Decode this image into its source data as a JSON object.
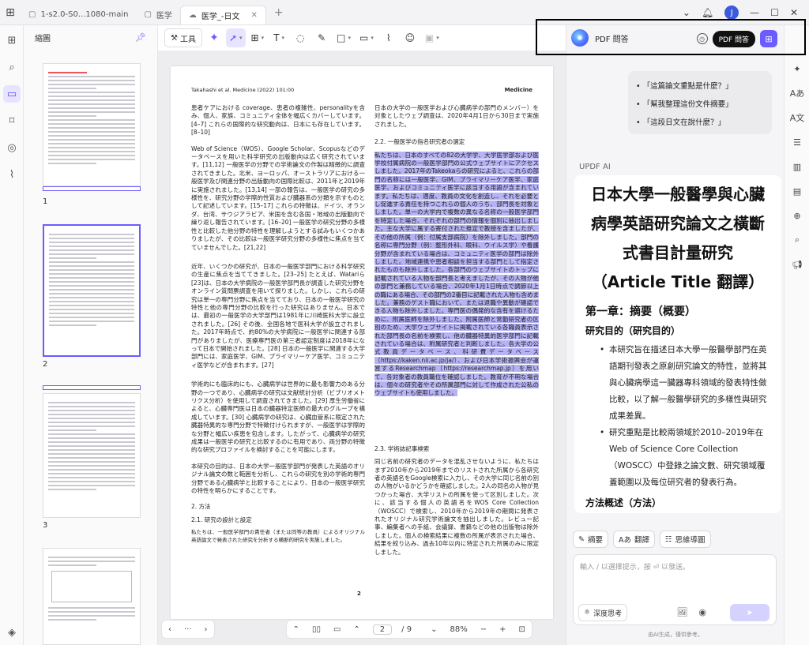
{
  "tabs": [
    {
      "label": "1-s2.0-S0...1080-main",
      "active": false
    },
    {
      "label": "医学",
      "active": false
    },
    {
      "label": "医学_-日文",
      "active": true
    }
  ],
  "avatar_initial": "J",
  "thumbnails": {
    "title": "縮圖",
    "pages": [
      "1",
      "2",
      "3"
    ]
  },
  "toolbar": {
    "tools_label": "工具"
  },
  "document": {
    "header_left": "Takahashi et al. Medicine (2022) 101:00",
    "header_right": "Medicine",
    "left_col": [
      "患者ケアにおける coverage、患者の複雑性、personalityを含み、個人、家族、コミュニティ全体を幅広くカバーしています。[4–7] これらの国際的な研究動向は、日本にも存在しています。[8–10]",
      "Web of Science（WOS）、Google Scholar、Scopusなどのデータベースを用いた科学研究の出版動向は広く研究されています。[11,12] 一般医学の分野での学術論文の作製は精緻的に調査されてきました。北米、ヨーロッパ、オーストラリアにおける一般医学及び関連分野の出版動向の国際比較は、2011年と2019年に実施されました。[13,14] 一部の報告は、一般医学の研究の多様性を、研究分野の学際的性質および臓器系の分類を示すものとして記述しています。[15–17] これらの特徴は、ドイツ、オランダ、台湾、サウジアラビア、米国を含む各国・地域の出版動向で繰り返し報告されています。[16–20] 一般医学の研究分野の多様性と比較した他分野の特性を理解しようとする試みもいくつかありましたが、その比較は一般医学研究分野の多様性に焦点を当てていませんでした。[21,22]",
      "近年、いくつかの研究が、日本の一般医学部門における科学研究の生産に焦点を当ててきました。[23–25] たとえば、Watariら[23]は、日本の大学病院の一般医学部門長が調査した研究分野をオンライン質問票調査を用いて探りました。しかし、これらの研究は単一の専門分野に焦点を当てており、日本の一般医学研究の特性と他の専門分野の比較を行った研究はありません。日本では、最初の一般医学の大学部門は1981年に川崎医科大学に設立されました。[26] その後、全国各地で医科大学が設立されました。2017年時点で、約80%の大学病院に一般医学に関連する部門がありましたが、医療専門医の第三者認定制度は2018年になって日本で開始されました。[28] 日本の一般医学に関連する大学部門には、家庭医学、GIM、プライマリーケア医学、コミュニティ医学などが含まれます。[27]",
      "学術的にも臨床的にも、心臓病学は世界的に最も影響力のある分野の一つであり、心臓病学の研究は文献統計分析（ビブリオメトリクス分析）を使用して調査されてきました。[29] 厚生労働省によると、心臓専門医は日本の臓器特定医師の最大のグループを構成しています。[30] 心臓病学の研究は、心臓血管系に限定された臓器特異的な専門分野で特徴付けられますが、一般医学は学際的な分野と幅広い疾患を包含します。したがって、心臓病学の研究成果は一般医学の研究と比較するのに有用であり、両分野の特徴的な研究プロファイルを検討することを可能にします。",
      "本研究の目的は、日本の大学一般医学部門が発表した英語のオリジナル論文の数と範囲を分析し、これらの研究を別の学術的専門分野である心臓病学と比較することにより、日本の一般医学研究の特性を明らかにすることです。"
    ],
    "left_h_methods": "2. 方法",
    "left_h_design": "2.1. 研究の設計と設定",
    "left_tail": "私たちは、一般医学部門の責任者（または同等の教員）によるオリジナル英語論文で発表された研究を分析する横断的研究を実施しました。",
    "right_top": "日本の大学の一般医学および心臓病学の部門のメンバー）を対象としたウェブ調査は、2020年4月1日から30日まで実施されました。",
    "right_h_22": "2.2. 一般医学の指名研究者の選定",
    "right_highlight": "私たちは、日本のすべての82の大学学、大学医学部および医学校付属病院の一般医学部門の公式ウェブサイトにアクセスしました。2017年のTakeokaらの研究によると、これらの部門の名称には一般医学、GIM、プライマリーケア医学、家庭医学、およびコミュニティ医学に該当する用語が含まれています。私たちは、適度、教員の文化を創造し、それを必要とし促進する責任を持つこれらの個人のうち、部門長を対象としました。単一の大学内で複数の異なる名称の一般医学部門を特定した場合、それぞれの部門の情報を個別に抽出しました。主な大学に属する寄付された推定で教授を含ましたが、その他の所属（例：付属支部病院）を除外しました。部門の名称に専門分野（例：整形外科、眼科、ウイルス学）や看護分野が含まれている場合は、コミュニティ医学の部門は除外しました。地域連携や患者相談を担当する部門として指定されたものも除外しました。各部門のウェブサイトのトップに記載されている人物を部門長と考えましたが、その人物が他の部門と兼務している場合、2020年1月1日時点で調節以上の職にある場合、その部門の2番目に記載された人物も含めました。兼務のゲスト職において、または退職や異動が確認できる人物も除外しました。専門医の偶発的な含有を避けるために、附属医師を除外しました。附属医師と常勤研究者の区別のため、大学ウェブサイトに掲載されている各職員表示された部門長の名前を検索し、他の臓器特異的医学部門に記載されている場合は、附属研究者と判断しました。各大学の公式教員データベース、科研費データベース（https://kaken.nii.ac.jp/ja/）、および日本学術振興会が運営するResearchmap（https://researchmap.jp）を用いて、各対象者の教員職位を確認しました。教育が不明な場合は、個々の研究者やその所属部門に対して作成された公私のウェブサイトも使用しました。",
    "right_h_23": "2.3. 学術誌記事検索",
    "right_23": "同じ名前の研究者のデータを混乱させないように、私たちはまず2010年から2019年までのリストされた所属から各研究者の英語名をGoogle検索に入力し、その大学に同じ名前の別の人物がいるかどうかを確認しました。2人の同名の人物が見つかった場合、大学リストの所属を使って区別しました。次に、該当する個人の英語名をWOS Core Collection（WOSCC）で検索し、2010年から2019年の期間に発表されたオリジナル研究学術論文を抽出しました。レビュー記事、編集者への手紙、会議録、書籍などの他の出版物は除外しました。個人の検索結果に複数の所属が表示された場合、結果を絞り込み、過去10年以内に特定された所属のみに限定しました。",
    "page_number": "2"
  },
  "bottom_bar": {
    "page_current": "2",
    "page_total": "/ 9",
    "zoom": "88%"
  },
  "panel": {
    "title": "PDF 問答",
    "tooltip": "PDF 問答",
    "suggestions": [
      "「這篇論文重點是什麼？」",
      "「幫我整理這份文件摘要」",
      "「這段日文在說什麼？」"
    ],
    "ai_label": "UPDF AI",
    "answer_title": "日本大學一般醫學與心臟病學英語研究論文之橫斷式書目計量研究（Article Title 翻譯）",
    "answer_h2": "第一章：摘要（概要）",
    "answer_h3a": "研究目的（研究目的）",
    "answer_bullets": [
      "本研究旨在描述日本大學一般醫學部門在英語期刊發表之原創研究論文的特性，並將其與心臟病學這一臟器專科領域的發表特性做比較，以了解一般醫學研究的多樣性與研究成果差異。",
      "研究重點是比較兩領域於2010–2019年在Web of Science Core Collection（WOSCC）中登錄之論文數、研究領域覆蓋範圍以及每位研究者的發表行為。"
    ],
    "answer_h3b": "方法概述（方法）",
    "chips": [
      "摘要",
      "翻譯",
      "思維導圖"
    ],
    "input_placeholder": "輸入 / 以選擇提示，按 ⏎ 以發送。",
    "deep_think": "深度思考",
    "footnote": "由AI生成，僅供參考。"
  }
}
